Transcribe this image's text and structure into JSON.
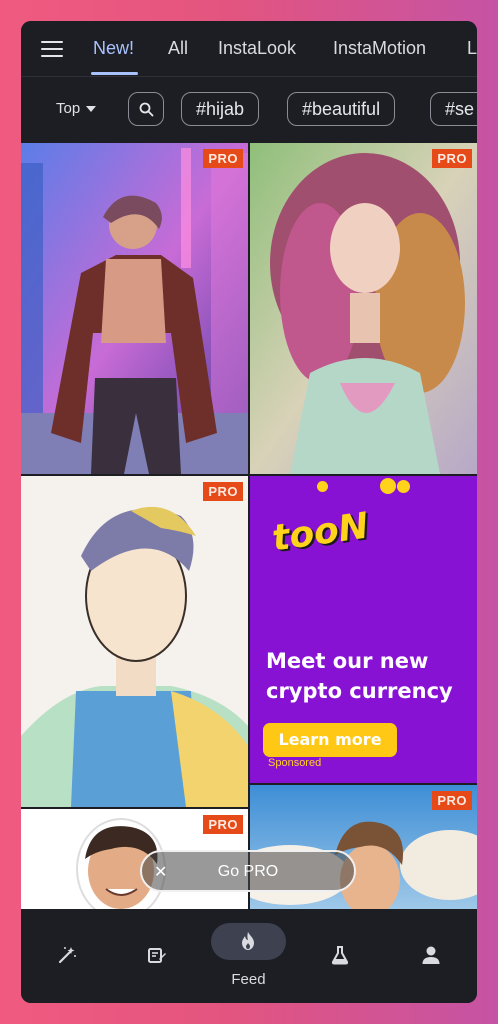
{
  "tabs": {
    "items": [
      {
        "label": "New!",
        "active": true
      },
      {
        "label": "All"
      },
      {
        "label": "InstaLook"
      },
      {
        "label": "InstaMotion"
      },
      {
        "label": "L"
      }
    ]
  },
  "filters": {
    "sort_label": "Top",
    "chips": [
      "#hijab",
      "#beautiful",
      "#se"
    ]
  },
  "grid": {
    "badge": "PRO"
  },
  "ad": {
    "logo": "tooN",
    "headline": "Meet our new crypto currency",
    "button": "Learn more",
    "sponsored": "Sponsored"
  },
  "promo": {
    "go_pro": "Go PRO",
    "close": "✕"
  },
  "bottom_nav": {
    "feed_label": "Feed"
  },
  "colors": {
    "accent": "#a9c2ff",
    "badge": "#e64a19",
    "ad_bg": "#8712d3",
    "ad_yellow": "#ffd21c"
  }
}
